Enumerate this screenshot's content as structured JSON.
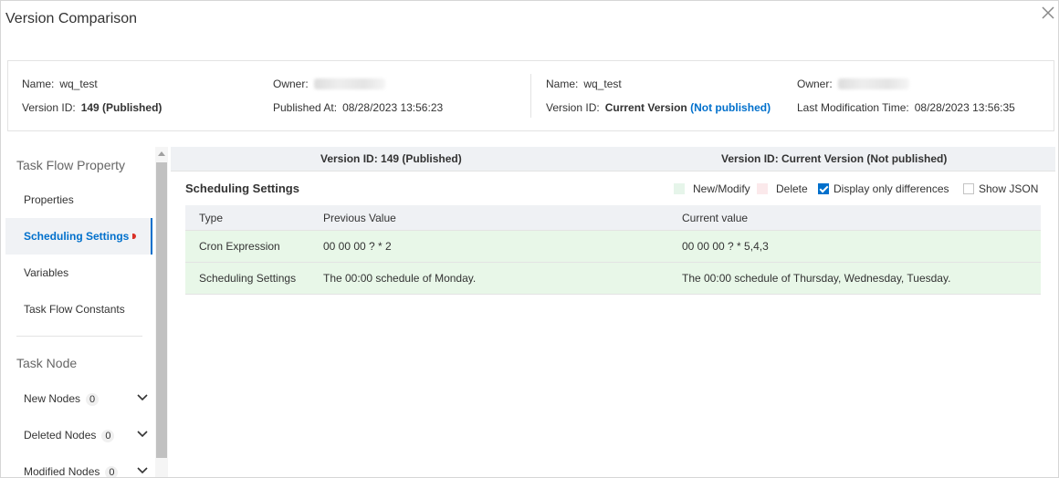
{
  "dialog": {
    "title": "Version Comparison"
  },
  "info": {
    "left": {
      "name_label": "Name:",
      "name_value": "wq_test",
      "owner_label": "Owner:",
      "version_label": "Version ID:",
      "version_value": "149 (Published)",
      "published_label": "Published At:",
      "published_value": "08/28/2023 13:56:23"
    },
    "right": {
      "name_label": "Name:",
      "name_value": "wq_test",
      "owner_label": "Owner:",
      "version_label": "Version ID:",
      "version_value": "Current Version",
      "version_status": "(Not published)",
      "modified_label": "Last Modification Time:",
      "modified_value": "08/28/2023 13:56:35"
    }
  },
  "sidebar": {
    "group1": "Task Flow Property",
    "items": [
      "Properties",
      "Scheduling Settings",
      "Variables",
      "Task Flow Constants"
    ],
    "active_index": 1,
    "group2": "Task Node",
    "nodes": [
      {
        "label": "New Nodes",
        "count": "0"
      },
      {
        "label": "Deleted Nodes",
        "count": "0"
      },
      {
        "label": "Modified Nodes",
        "count": "0"
      }
    ]
  },
  "compare_header": {
    "left": "Version ID: 149 (Published)",
    "right": "Version ID: Current Version",
    "right_status": "(Not published)"
  },
  "section": {
    "title": "Scheduling Settings",
    "legend_new": "New/Modify",
    "legend_delete": "Delete",
    "only_diff_label": "Display only differences",
    "only_diff_checked": true,
    "show_json_label": "Show JSON",
    "show_json_checked": false
  },
  "table": {
    "columns": [
      "Type",
      "Previous Value",
      "Current value"
    ],
    "rows": [
      [
        "Cron Expression",
        "00 00 00 ? * 2",
        "00 00 00 ? * 5,4,3"
      ],
      [
        "Scheduling Settings",
        "The 00:00 schedule of Monday.",
        "The 00:00 schedule of Thursday, Wednesday, Tuesday."
      ]
    ]
  },
  "colors": {
    "accent": "#0070cc",
    "modified_bg": "#e8f7e8",
    "new_swatch": "#e6f5ea",
    "delete_swatch": "#fbe9eb",
    "changed_marker": "#d93026"
  }
}
